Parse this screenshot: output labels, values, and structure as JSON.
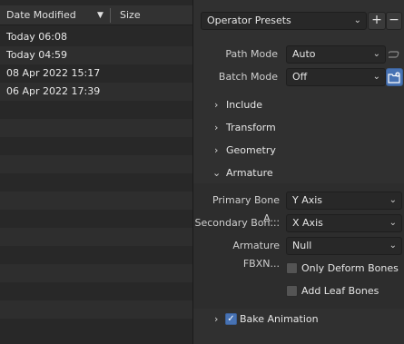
{
  "file_list": {
    "columns": {
      "date_modified": "Date Modified",
      "size": "Size"
    },
    "rows": [
      {
        "date": "Today 06:08",
        "size": ""
      },
      {
        "date": "Today 04:59",
        "size": ""
      },
      {
        "date": "08 Apr 2022 15:17",
        "size": ""
      },
      {
        "date": "06 Apr 2022 17:39",
        "size": ""
      }
    ]
  },
  "presets": {
    "label": "Operator Presets",
    "add": "+",
    "remove": "−"
  },
  "path_mode": {
    "label": "Path Mode",
    "value": "Auto"
  },
  "batch_mode": {
    "label": "Batch Mode",
    "value": "Off"
  },
  "sections": {
    "include": "Include",
    "transform": "Transform",
    "geometry": "Geometry",
    "armature": "Armature",
    "bake_animation": "Bake Animation"
  },
  "armature": {
    "primary_bone_axis": {
      "label": "Primary Bone A...",
      "value": "Y Axis"
    },
    "secondary_bone_axis": {
      "label": "Secondary Bon...",
      "value": "X Axis"
    },
    "armature_fbxnode": {
      "label": "Armature FBXN...",
      "value": "Null"
    },
    "only_deform_bones": {
      "label": "Only Deform Bones",
      "checked": false
    },
    "add_leaf_bones": {
      "label": "Add Leaf Bones",
      "checked": false
    }
  },
  "bake_animation_checked": true,
  "icons": {
    "sort": "sort-down-icon",
    "expand": "chevron-right-icon",
    "collapse": "chevron-down-icon",
    "dropdown": "chevron-down-icon",
    "path_toggle": "link-toggle-icon",
    "new_folder": "new-folder-icon"
  },
  "colors": {
    "accent": "#4772b3",
    "panel": "#303030",
    "list": "#282828"
  }
}
